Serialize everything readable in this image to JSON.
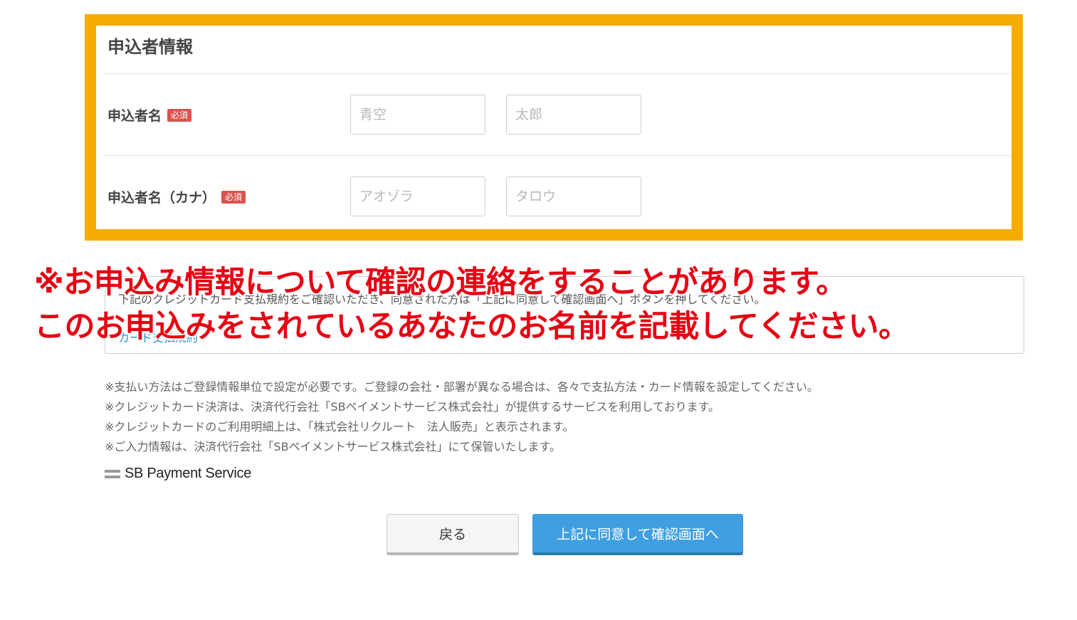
{
  "section": {
    "title": "申込者情報",
    "rows": [
      {
        "label": "申込者名",
        "required": "必須",
        "inputs": [
          {
            "placeholder": "青空"
          },
          {
            "placeholder": "太郎"
          }
        ]
      },
      {
        "label": "申込者名（カナ）",
        "required": "必須",
        "inputs": [
          {
            "placeholder": "アオゾラ"
          },
          {
            "placeholder": "タロウ"
          }
        ]
      }
    ]
  },
  "terms": {
    "text": "下記のクレジットカード支払規約をご確認いただき、同意された方は「上記に同意して確認画面へ」ボタンを押してください。",
    "link": "カード支払規約"
  },
  "overlay": {
    "line1": "※お申込み情報について確認の連絡をすることがあります。",
    "line2": "このお申込みをされているあなたのお名前を記載してください。"
  },
  "notes": [
    "※支払い方法はご登録情報単位で設定が必要です。ご登録の会社・部署が異なる場合は、各々で支払方法・カード情報を設定してください。",
    "※クレジットカード決済は、決済代行会社「SBペイメントサービス株式会社」が提供するサービスを利用しております。",
    "※クレジットカードのご利用明細上は、「株式会社リクルート　法人販売」と表示されます。",
    "※ご入力情報は、決済代行会社「SBペイメントサービス株式会社」にて保管いたします。"
  ],
  "logo": {
    "text": "SB Payment Service"
  },
  "buttons": {
    "back": "戻る",
    "next": "上記に同意して確認画面へ"
  },
  "colors": {
    "highlight": "#f6ab00",
    "overlay_text": "#e60012",
    "primary_button": "#3f9fe0",
    "required_badge": "#d9534f",
    "link": "#2a8fd1"
  }
}
